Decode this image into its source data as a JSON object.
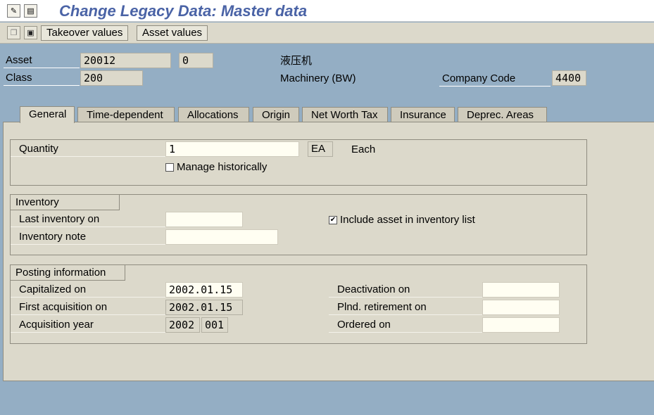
{
  "window": {
    "title": "Change Legacy Data: Master data"
  },
  "toolbar": {
    "takeover_label": "Takeover values",
    "asset_values_label": "Asset values"
  },
  "header": {
    "asset_label": "Asset",
    "asset_number": "20012",
    "asset_subnumber": "0",
    "asset_description": "液压机",
    "class_label": "Class",
    "class_value": "200",
    "class_description": "Machinery (BW)",
    "company_code_label": "Company Code",
    "company_code_value": "4400"
  },
  "tabs": [
    {
      "label": "General",
      "active": true
    },
    {
      "label": "Time-dependent"
    },
    {
      "label": "Allocations"
    },
    {
      "label": "Origin"
    },
    {
      "label": "Net Worth Tax"
    },
    {
      "label": "Insurance"
    },
    {
      "label": "Deprec. Areas"
    }
  ],
  "general": {
    "quantity_label": "Quantity",
    "quantity_value": "1",
    "unit_code": "EA",
    "unit_text": "Each",
    "manage_historically_label": "Manage historically",
    "manage_historically_checked": false
  },
  "inventory": {
    "title": "Inventory",
    "last_inventory_label": "Last inventory on",
    "last_inventory_value": "",
    "inventory_note_label": "Inventory note",
    "inventory_note_value": "",
    "include_list_label": "Include asset in inventory list",
    "include_list_checked": true
  },
  "posting": {
    "title": "Posting information",
    "capitalized_label": "Capitalized on",
    "capitalized_value": "2002.01.15",
    "first_acq_label": "First acquisition on",
    "first_acq_value": "2002.01.15",
    "acq_year_label": "Acquisition year",
    "acq_year_value": "2002",
    "acq_period_value": "001",
    "deactivation_label": "Deactivation on",
    "deactivation_value": "",
    "plnd_retirement_label": "Plnd. retirement on",
    "plnd_retirement_value": "",
    "ordered_label": "Ordered on",
    "ordered_value": ""
  },
  "colors": {
    "background": "#94aec4",
    "panel": "#dcd9cb",
    "title_text": "#4a63a6",
    "input": "#fffef2"
  }
}
